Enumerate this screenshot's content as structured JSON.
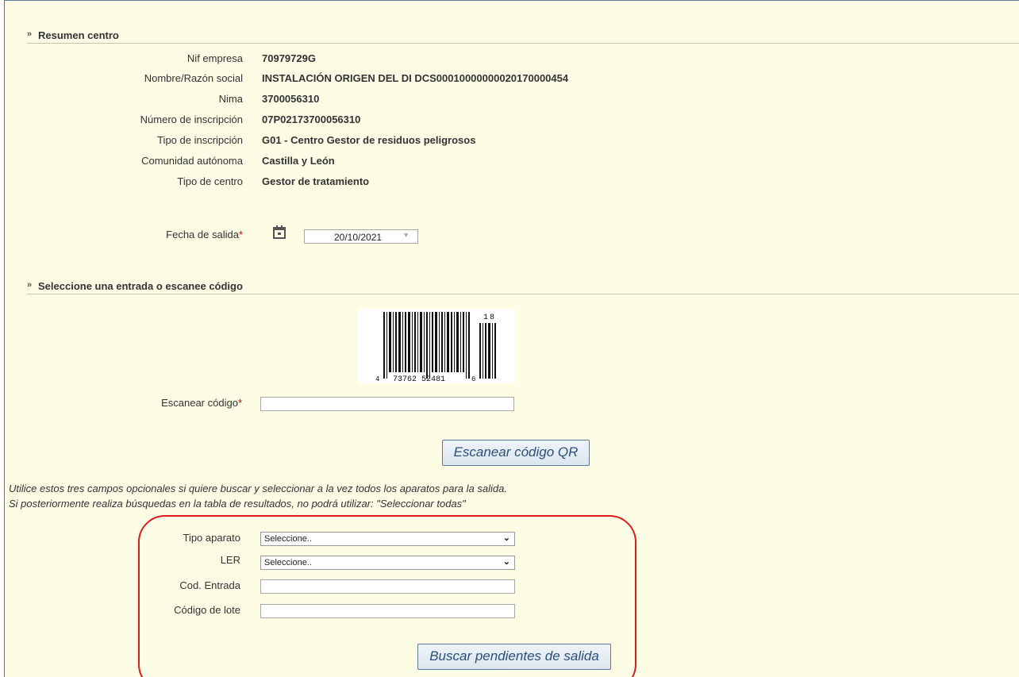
{
  "sections": {
    "summary_title": "Resumen centro",
    "select_title": "Seleccione una entrada o escanee código"
  },
  "summary": [
    {
      "label": "Nif empresa",
      "value": "70979729G"
    },
    {
      "label": "Nombre/Razón social",
      "value": "INSTALACIÓN ORIGEN DEL DI DCS00010000000020170000454"
    },
    {
      "label": "Nima",
      "value": "3700056310"
    },
    {
      "label": "Número de inscripción",
      "value": "07P02173700056310"
    },
    {
      "label": "Tipo de inscripción",
      "value": "G01 - Centro Gestor de residuos peligrosos"
    },
    {
      "label": "Comunidad autónoma",
      "value": "Castilla y León"
    },
    {
      "label": "Tipo de centro",
      "value": "Gestor de tratamiento"
    }
  ],
  "fecha": {
    "label": "Fecha de salida",
    "required_mark": "*",
    "value": "20/10/2021",
    "icon": "calendar-icon"
  },
  "barcode": {
    "digits_bottom_left": "4",
    "digits_bottom_mid": "73762 52481",
    "digits_bottom_right": "6",
    "addon_digits": "18"
  },
  "scan": {
    "label": "Escanear código",
    "required_mark": "*",
    "value": "",
    "button_label": "Escanear código QR"
  },
  "notes": {
    "line1": "Utilice estos tres campos opcionales si quiere buscar y seleccionar a la vez todos los aparatos para la salida.",
    "line2": "Si posteriormente realiza búsquedas en la tabla de resultados, no podrá utilizar: \"Seleccionar todas\""
  },
  "filters": {
    "tipo_label": "Tipo aparato",
    "tipo_selected": "Seleccione..",
    "ler_label": "LER",
    "ler_selected": "Seleccione..",
    "cod_entrada_label": "Cod. Entrada",
    "cod_entrada_value": "",
    "lote_label": "Código de lote",
    "lote_value": "",
    "search_button": "Buscar pendientes de salida"
  },
  "colors": {
    "panel_bg": "#fdfde6",
    "button_text": "#2a4f7a",
    "required": "#cc0000",
    "highlight": "#d81e1e"
  }
}
